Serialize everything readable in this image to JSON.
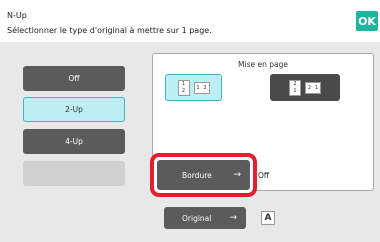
{
  "header": {
    "title": "N-Up",
    "subtitle": "Sélectionner le type d'original à mettre sur 1 page.",
    "ok_label": "OK"
  },
  "nup_options": [
    {
      "label": "Off",
      "state": "normal"
    },
    {
      "label": "2-Up",
      "state": "selected"
    },
    {
      "label": "4-Up",
      "state": "normal"
    },
    {
      "label": "",
      "state": "disabled"
    }
  ],
  "layout_panel": {
    "title": "Mise en page",
    "options": [
      {
        "left_pages": [
          "1",
          "2"
        ],
        "right_pages": [
          "1",
          "2"
        ],
        "selected": true
      },
      {
        "left_pages": [
          "2",
          "1"
        ],
        "right_pages": [
          "2",
          "1"
        ],
        "selected": false
      }
    ]
  },
  "border": {
    "label": "Bordure",
    "value": "Off"
  },
  "original": {
    "label": "Original",
    "icon_glyph": "A"
  },
  "colors": {
    "accent": "#1db5a0",
    "selected_fill": "#bdeef4",
    "selected_border": "#39b7c6",
    "highlight": "#e0202e",
    "dark_button": "#5b5b5b"
  }
}
